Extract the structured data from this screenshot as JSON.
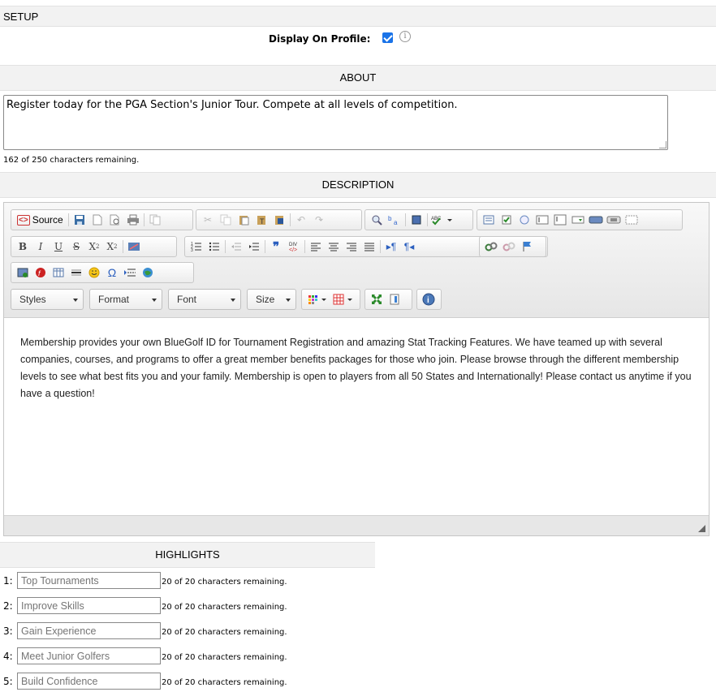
{
  "setup": {
    "title": "SETUP",
    "display_on_profile_label": "Display On Profile:",
    "display_on_profile_checked": true
  },
  "about": {
    "title": "ABOUT",
    "text": "Register today for the PGA Section's Junior Tour. Compete at all levels of competition.",
    "remaining": "162 of 250 characters remaining."
  },
  "description": {
    "title": "DESCRIPTION",
    "toolbar": {
      "source_label": "Source",
      "styles_label": "Styles",
      "format_label": "Format",
      "font_label": "Font",
      "size_label": "Size"
    },
    "content": "Membership provides your own BlueGolf ID for Tournament Registration and amazing Stat Tracking Features. We have teamed up with several companies, courses, and programs to offer a great member benefits packages for those who join. Please browse through the different membership levels to see what best fits you and your family. Membership is open to players from all 50 States and Internationally! Please contact us anytime if you have a question!"
  },
  "highlights": {
    "title": "HIGHLIGHTS",
    "items": [
      {
        "num": "1:",
        "placeholder": "Top Tournaments",
        "remaining": "20 of 20 characters remaining."
      },
      {
        "num": "2:",
        "placeholder": "Improve Skills",
        "remaining": "20 of 20 characters remaining."
      },
      {
        "num": "3:",
        "placeholder": "Gain Experience",
        "remaining": "20 of 20 characters remaining."
      },
      {
        "num": "4:",
        "placeholder": "Meet Junior Golfers",
        "remaining": "20 of 20 characters remaining."
      },
      {
        "num": "5:",
        "placeholder": "Build Confidence",
        "remaining": "20 of 20 characters remaining."
      }
    ]
  },
  "colors": {
    "section_bg": "#f2f2f2",
    "checkbox": "#1a73e8",
    "editor_border": "#c6c6c6"
  }
}
